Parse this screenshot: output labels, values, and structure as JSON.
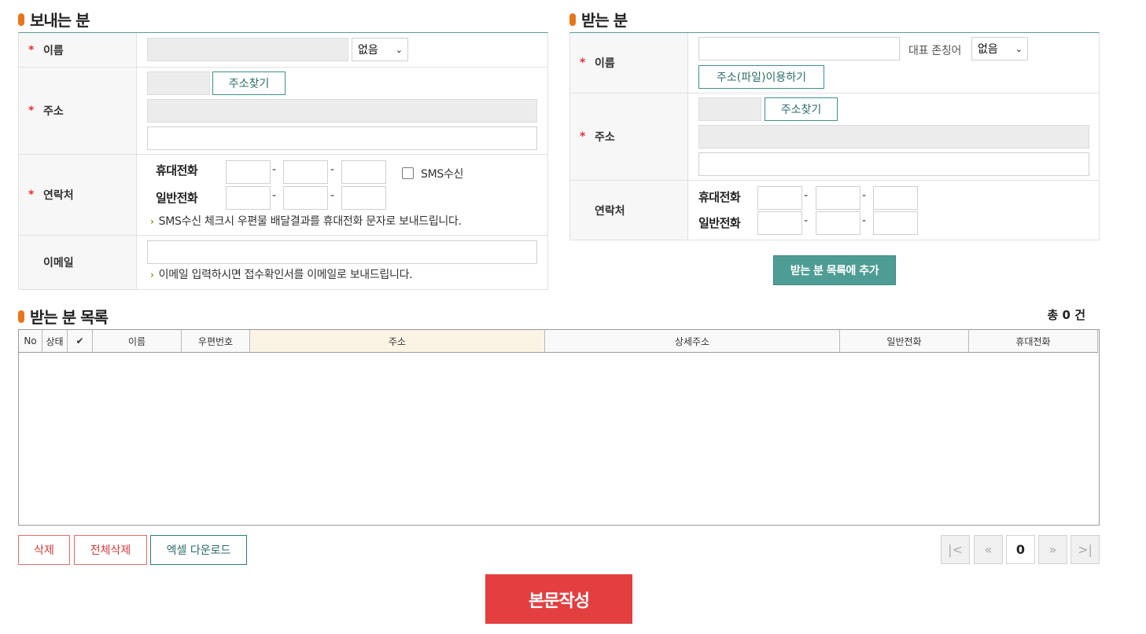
{
  "sender": {
    "title": "보내는 분",
    "name_label": "이름",
    "honorific_select": "없음",
    "address_label": "주소",
    "address_search_btn": "주소찾기",
    "contact_label": "연락처",
    "mobile_label": "휴대전화",
    "landline_label": "일반전화",
    "sms_label": "SMS수신",
    "sms_note": "SMS수신 체크시 우편물 배달결과를 휴대전화 문자로 보내드립니다.",
    "email_label": "이메일",
    "email_note": "이메일 입력하시면 접수확인서를 이메일로 보내드립니다."
  },
  "recipient": {
    "title": "받는 분",
    "name_label": "이름",
    "honorific_label": "대표 존칭어",
    "honorific_select": "없음",
    "address_file_btn": "주소(파일)이용하기",
    "address_label": "주소",
    "address_search_btn": "주소찾기",
    "contact_label": "연락처",
    "mobile_label": "휴대전화",
    "landline_label": "일반전화",
    "add_button": "받는 분 목록에 추가"
  },
  "list": {
    "title": "받는 분 목록",
    "total": "총 0 건",
    "columns": [
      "No",
      "상태",
      "✔",
      "이름",
      "우편번호",
      "주소",
      "상세주소",
      "일반전화",
      "휴대전화"
    ]
  },
  "actions": {
    "delete": "삭제",
    "delete_all": "전체삭제",
    "excel_download": "엑셀 다운로드",
    "compose": "본문작성"
  },
  "pagination": {
    "first": "|<",
    "prev": "«",
    "current": "0",
    "next": "»",
    "last": ">|"
  },
  "symbols": {
    "required": "*",
    "dash": "-",
    "note_arrow": "›",
    "select_chevron": "⌄"
  }
}
